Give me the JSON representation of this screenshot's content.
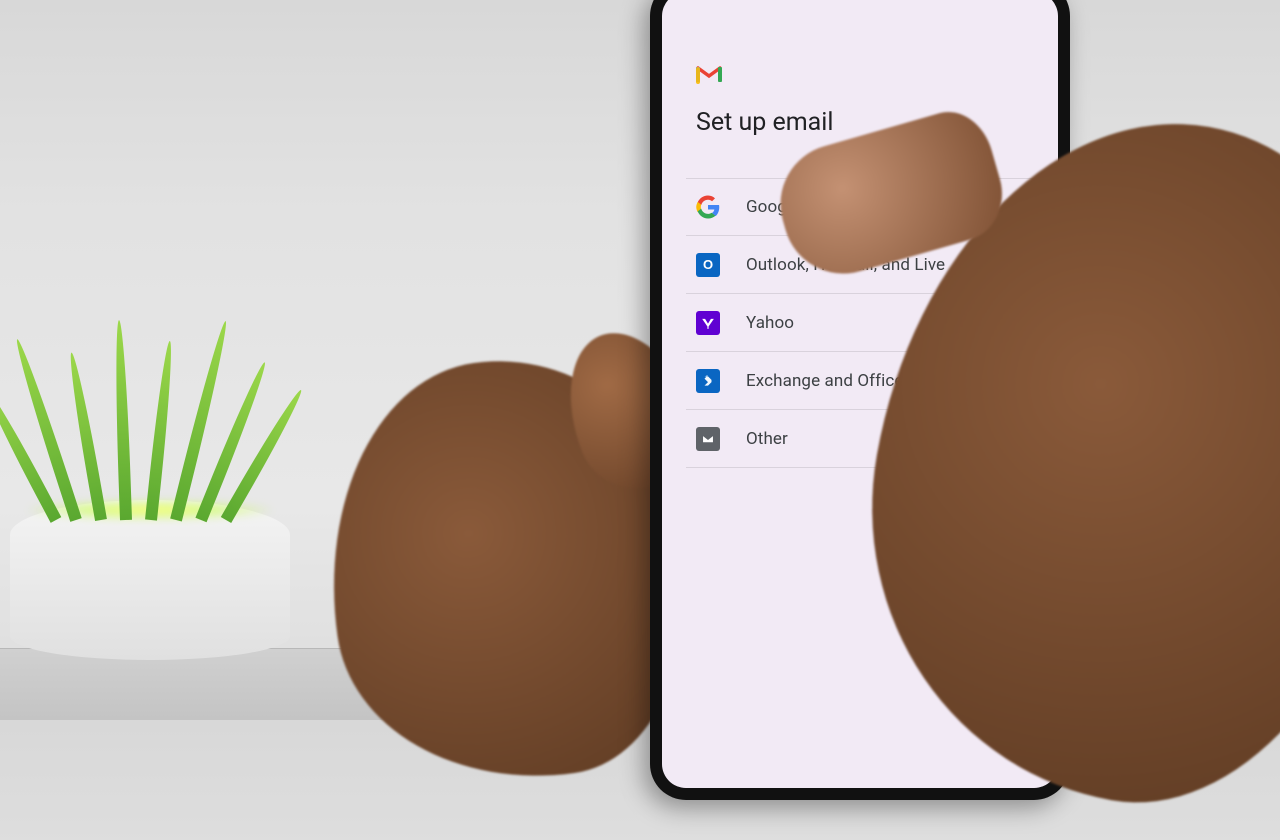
{
  "screen": {
    "title": "Set up email",
    "providers": [
      {
        "id": "google",
        "label": "Google"
      },
      {
        "id": "outlook",
        "label": "Outlook, Hotmail, and Live"
      },
      {
        "id": "yahoo",
        "label": "Yahoo"
      },
      {
        "id": "exchange",
        "label": "Exchange and Office 365"
      },
      {
        "id": "other",
        "label": "Other"
      }
    ]
  },
  "colors": {
    "screen_bg": "#f2eaf5",
    "text_primary": "#202124",
    "text_secondary": "#3c4043",
    "yahoo": "#6001d2",
    "outlook": "#0a66c2",
    "exchange": "#107c41",
    "other": "#5f6368"
  }
}
